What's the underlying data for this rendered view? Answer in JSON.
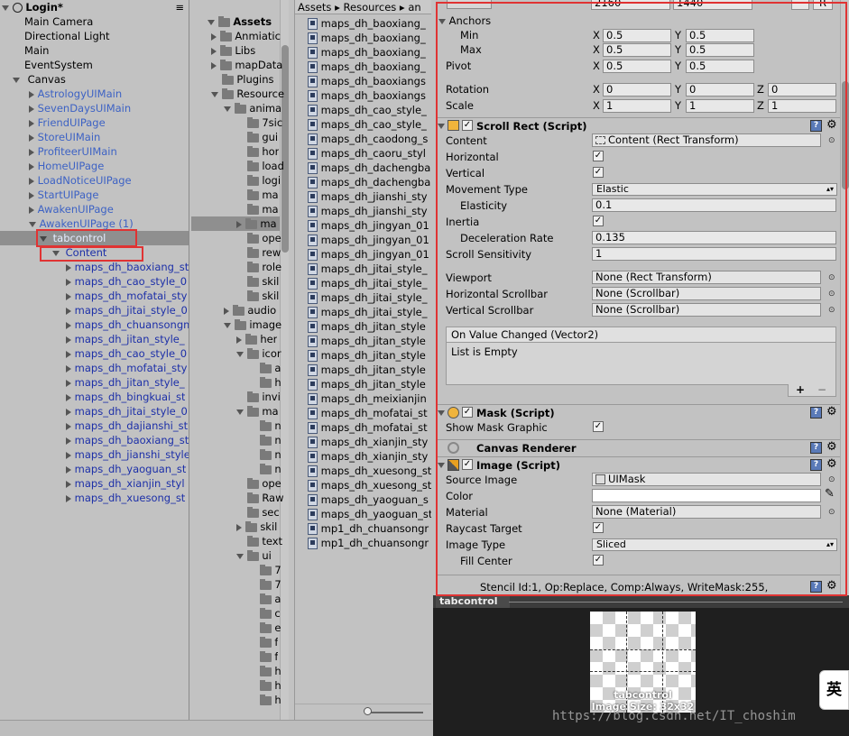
{
  "hierarchy": {
    "scene_title": "Login*",
    "menu_icon": "≡",
    "roots": [
      "Main Camera",
      "Directional Light",
      "Main",
      "EventSystem"
    ],
    "canvas_label": "Canvas",
    "ui_pages": [
      "AstrologyUIMain",
      "SevenDaysUIMain",
      "FriendUIPage",
      "StoreUIMain",
      "ProfiteerUIMain",
      "HomeUIPage",
      "LoadNoticeUIPage",
      "StartUIPage",
      "AwakenUIPage",
      "AwakenUIPage (1)"
    ],
    "selected": "tabcontrol",
    "content_label": "Content",
    "content_children": [
      "maps_dh_baoxiang_st",
      "maps_dh_cao_style_0",
      "maps_dh_mofatai_sty",
      "maps_dh_jitai_style_0",
      "maps_dh_chuansongm",
      "maps_dh_jitan_style_",
      "maps_dh_cao_style_0",
      "maps_dh_mofatai_sty",
      "maps_dh_jitan_style_",
      "maps_dh_bingkuai_st",
      "maps_dh_jitai_style_0",
      "maps_dh_dajianshi_st",
      "maps_dh_baoxiang_st",
      "maps_dh_jianshi_style",
      "maps_dh_yaoguan_st",
      "maps_dh_xianjin_styl",
      "maps_dh_xuesong_st"
    ]
  },
  "assets_tree": {
    "root": "Assets",
    "items": [
      "Anmiatic",
      "Libs",
      "mapData",
      "Plugins",
      "Resource",
      "anima",
      "7sic",
      "gui",
      "hor",
      "load",
      "logi",
      "ma",
      "ma",
      "ma",
      "ope",
      "rew",
      "role",
      "skil",
      "skil",
      "audio",
      "image",
      "her",
      "icor",
      "a",
      "h",
      "invi",
      "ma",
      "n",
      "n",
      "n",
      "n",
      "ope",
      "Raw",
      "sec",
      "skil",
      "text",
      "ui",
      "7",
      "7",
      "a",
      "c",
      "e",
      "f",
      "f",
      "h",
      "h",
      "h"
    ]
  },
  "breadcrumb": [
    "Assets",
    "Resources",
    "an"
  ],
  "files": [
    "maps_dh_baoxiang_",
    "maps_dh_baoxiang_",
    "maps_dh_baoxiang_",
    "maps_dh_baoxiang_",
    "maps_dh_baoxiangs",
    "maps_dh_baoxiangs",
    "maps_dh_cao_style_",
    "maps_dh_cao_style_",
    "maps_dh_caodong_s",
    "maps_dh_caoru_styl",
    "maps_dh_dachengba",
    "maps_dh_dachengba",
    "maps_dh_jianshi_sty",
    "maps_dh_jianshi_sty",
    "maps_dh_jingyan_01",
    "maps_dh_jingyan_01",
    "maps_dh_jingyan_01",
    "maps_dh_jitai_style_",
    "maps_dh_jitai_style_",
    "maps_dh_jitai_style_",
    "maps_dh_jitai_style_",
    "maps_dh_jitan_style",
    "maps_dh_jitan_style",
    "maps_dh_jitan_style",
    "maps_dh_jitan_style",
    "maps_dh_jitan_style",
    "maps_dh_meixianjin",
    "maps_dh_mofatai_st",
    "maps_dh_mofatai_st",
    "maps_dh_xianjin_sty",
    "maps_dh_xianjin_sty",
    "maps_dh_xuesong_st",
    "maps_dh_xuesong_st",
    "maps_dh_yaoguan_s",
    "maps_dh_yaoguan_st",
    "mp1_dh_chuansongr",
    "mp1_dh_chuansongr"
  ],
  "inspector": {
    "size_w": "2160",
    "size_h": "1440",
    "anchors_label": "Anchors",
    "min_label": "Min",
    "max_label": "Max",
    "pivot_label": "Pivot",
    "rotation_label": "Rotation",
    "scale_label": "Scale",
    "x": "X",
    "y": "Y",
    "z": "Z",
    "min_x": "0.5",
    "min_y": "0.5",
    "max_x": "0.5",
    "max_y": "0.5",
    "pivot_x": "0.5",
    "pivot_y": "0.5",
    "rot_x": "0",
    "rot_y": "0",
    "rot_z": "0",
    "scale_x": "1",
    "scale_y": "1",
    "scale_z": "1",
    "scroll_rect": {
      "title": "Scroll Rect (Script)",
      "content_label": "Content",
      "content_value": "Content (Rect Transform)",
      "horizontal_label": "Horizontal",
      "vertical_label": "Vertical",
      "movement_label": "Movement Type",
      "movement_value": "Elastic",
      "elasticity_label": "Elasticity",
      "elasticity_value": "0.1",
      "inertia_label": "Inertia",
      "decel_label": "Deceleration Rate",
      "decel_value": "0.135",
      "sensitivity_label": "Scroll Sensitivity",
      "sensitivity_value": "1",
      "viewport_label": "Viewport",
      "viewport_value": "None (Rect Transform)",
      "hscroll_label": "Horizontal Scrollbar",
      "hscroll_value": "None (Scrollbar)",
      "vscroll_label": "Vertical Scrollbar",
      "vscroll_value": "None (Scrollbar)",
      "event_title": "On Value Changed (Vector2)",
      "event_empty": "List is Empty",
      "add": "+",
      "remove": "−"
    },
    "mask": {
      "title": "Mask (Script)",
      "show_label": "Show Mask Graphic"
    },
    "canvas_renderer": "Canvas Renderer",
    "image": {
      "title": "Image (Script)",
      "source_label": "Source Image",
      "source_value": "UIMask",
      "color_label": "Color",
      "material_label": "Material",
      "material_value": "None (Material)",
      "raycast_label": "Raycast Target",
      "type_label": "Image Type",
      "type_value": "Sliced",
      "fill_label": "Fill Center"
    },
    "stencil": "Stencil Id:1, Op:Replace, Comp:Always, WriteMask:255,",
    "r_btn": "R",
    "check": "✓",
    "help": "?",
    "gear": "⚙",
    "circle_dot": "⊙"
  },
  "preview": {
    "tab_label": "tabcontrol",
    "tab_menu": "⋮",
    "name": "tabcontrol",
    "size": "Image Size: 32x32",
    "ime": "英",
    "watermark": "https://blog.csdn.net/IT_choshim"
  },
  "colors": {
    "highlight_red": "#e03333",
    "selection_gray": "#8f8f8f",
    "blue_text": "#3d62c4",
    "navy_text": "#1c2fa8"
  }
}
